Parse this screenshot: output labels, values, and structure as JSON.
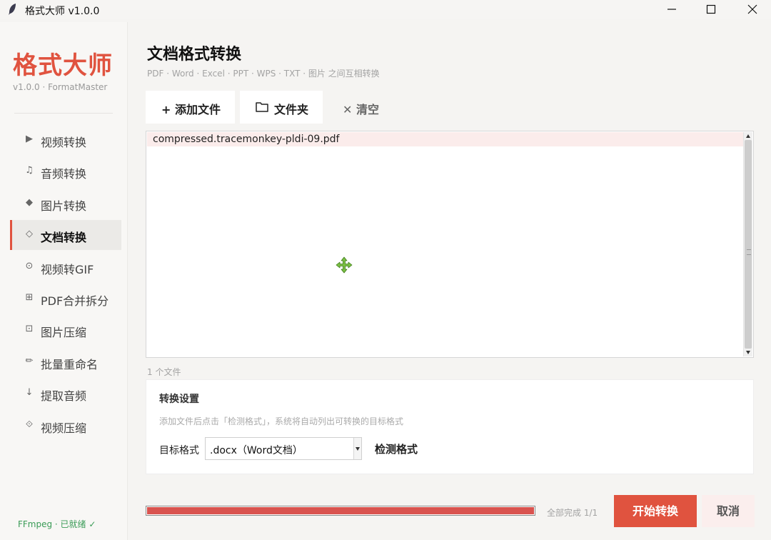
{
  "window": {
    "title": "格式大师 v1.0.0",
    "app_icon": "feather-icon"
  },
  "sidebar": {
    "brand": "格式大师",
    "brand_sub": "v1.0.0 · FormatMaster",
    "items": [
      {
        "label": "视频转换",
        "icon": "play-icon",
        "glyph": "▶",
        "active": false
      },
      {
        "label": "音频转换",
        "icon": "music-note-icon",
        "glyph": "♫",
        "active": false
      },
      {
        "label": "图片转换",
        "icon": "diamond-filled-icon",
        "glyph": "◆",
        "active": false
      },
      {
        "label": "文档转换",
        "icon": "diamond-outline-icon",
        "glyph": "◇",
        "active": true
      },
      {
        "label": "视频转GIF",
        "icon": "circle-dot-icon",
        "glyph": "⊙",
        "active": false
      },
      {
        "label": "PDF合并拆分",
        "icon": "squared-plus-icon",
        "glyph": "⊞",
        "active": false
      },
      {
        "label": "图片压缩",
        "icon": "squared-dot-icon",
        "glyph": "⊡",
        "active": false
      },
      {
        "label": "批量重命名",
        "icon": "pencil-icon",
        "glyph": "✏",
        "active": false
      },
      {
        "label": "提取音频",
        "icon": "down-arrow-icon",
        "glyph": "↓",
        "active": false
      },
      {
        "label": "视频压缩",
        "icon": "diamond-dot-icon",
        "glyph": "⟐",
        "active": false
      }
    ],
    "status": "FFmpeg · 已就绪 ✓"
  },
  "main": {
    "title": "文档格式转换",
    "subtitle": "PDF · Word · Excel · PPT · WPS · TXT · 图片 之间互相转换",
    "toolbar": {
      "add_file": "+ 添加文件",
      "folder": "文件夹",
      "clear": "✕ 清空"
    },
    "files": [
      "compressed.tracemonkey-pldi-09.pdf"
    ],
    "file_count": "1 个文件",
    "settings": {
      "title": "转换设置",
      "hint": "添加文件后点击「检测格式」，系统将自动列出可转换的目标格式",
      "target_label": "目标格式",
      "target_value": ".docx（Word文档）",
      "detect_button": "检测格式"
    },
    "progress": {
      "value": 1.0,
      "text": "全部完成  1/1"
    },
    "start_button": "开始转换",
    "cancel_button": "取消"
  },
  "colors": {
    "accent": "#e0533f",
    "status_ok": "#3a9b56",
    "progress": "#d9534f"
  }
}
